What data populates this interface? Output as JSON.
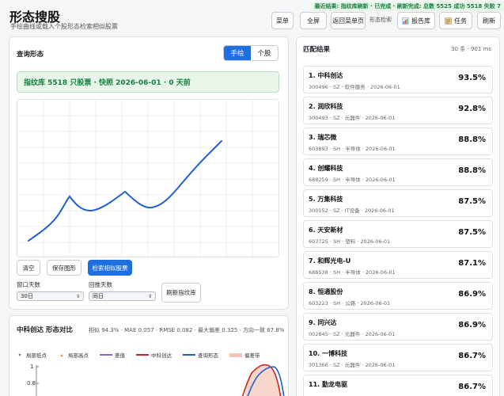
{
  "header": {
    "title": "形态搜股",
    "subtitle": "手绘曲线或载入个股形态检索相似股票",
    "banner": "最近结果: 指纹库刷新 · 已完成 · 刷新完成: 总数 5525 成功 5518 失败 7",
    "buttons": {
      "menu": "菜单",
      "fullscreen": "全屏",
      "back": "返回菜单页",
      "search_label": "形态检索",
      "report": "报告库",
      "tasks": "任务",
      "refresh": "刷新"
    }
  },
  "query": {
    "title": "查询形态",
    "mode_draw": "手绘",
    "mode_stock": "个股",
    "info": "指纹库 5518 只股票 · 快照 2026-06-01 · 0 天前",
    "clear": "清空",
    "save": "保存图形",
    "search": "检索相似股票",
    "window_label": "窗口天数",
    "window_value": "30日",
    "lookback_label": "回推天数",
    "lookback_value": "同日",
    "refresh_index": "刷新指纹库"
  },
  "compare": {
    "title": "中科创达 形态对比",
    "metrics": "相似 94.3% · MAE 0.057 · RMSE 0.082 · 最大偏差 0.325 · 方向一致 67.8%",
    "legend": [
      "局部低点",
      "局部高点",
      "差值",
      "中科创达",
      "查询形态",
      "偏差带"
    ],
    "y_ticks": [
      "1",
      "0.8"
    ]
  },
  "colors": {
    "accent": "#1e6fe0",
    "green": "#15803d",
    "query_line": "#1e5fd1",
    "stock_line": "#d22020",
    "diff_line": "#8a63d2",
    "band": "#f5c4b6"
  },
  "results": {
    "title": "匹配结果",
    "meta": "30 条 · 901 ms",
    "items": [
      {
        "name": "1. 中科创达",
        "meta": "300496 · SZ · 软件服务 · 2026-06-01",
        "pct": "93.5%"
      },
      {
        "name": "2. 润欣科技",
        "meta": "300493 · SZ · 元器件 · 2026-06-01",
        "pct": "92.8%"
      },
      {
        "name": "3. 瑞芯微",
        "meta": "603893 · SH · 半导体 · 2026-06-01",
        "pct": "88.8%"
      },
      {
        "name": "4. 创耀科技",
        "meta": "688259 · SH · 半导体 · 2026-06-01",
        "pct": "88.8%"
      },
      {
        "name": "5. 万集科技",
        "meta": "300552 · SZ · IT设备 · 2026-06-01",
        "pct": "87.5%"
      },
      {
        "name": "6. 天安新材",
        "meta": "603725 · SH · 塑料 · 2026-06-01",
        "pct": "87.5%"
      },
      {
        "name": "7. 和辉光电-U",
        "meta": "688538 · SH · 半导体 · 2026-06-01",
        "pct": "87.1%"
      },
      {
        "name": "8. 恒通股份",
        "meta": "603223 · SH · 公路 · 2026-06-01",
        "pct": "86.9%"
      },
      {
        "name": "9. 同兴达",
        "meta": "002845 · SZ · 元器件 · 2026-06-01",
        "pct": "86.9%"
      },
      {
        "name": "10. 一博科技",
        "meta": "301366 · SZ · 元器件 · 2026-06-01",
        "pct": "86.7%"
      },
      {
        "name": "11. 勤龙电驱",
        "meta": "",
        "pct": "86.7%"
      }
    ]
  }
}
